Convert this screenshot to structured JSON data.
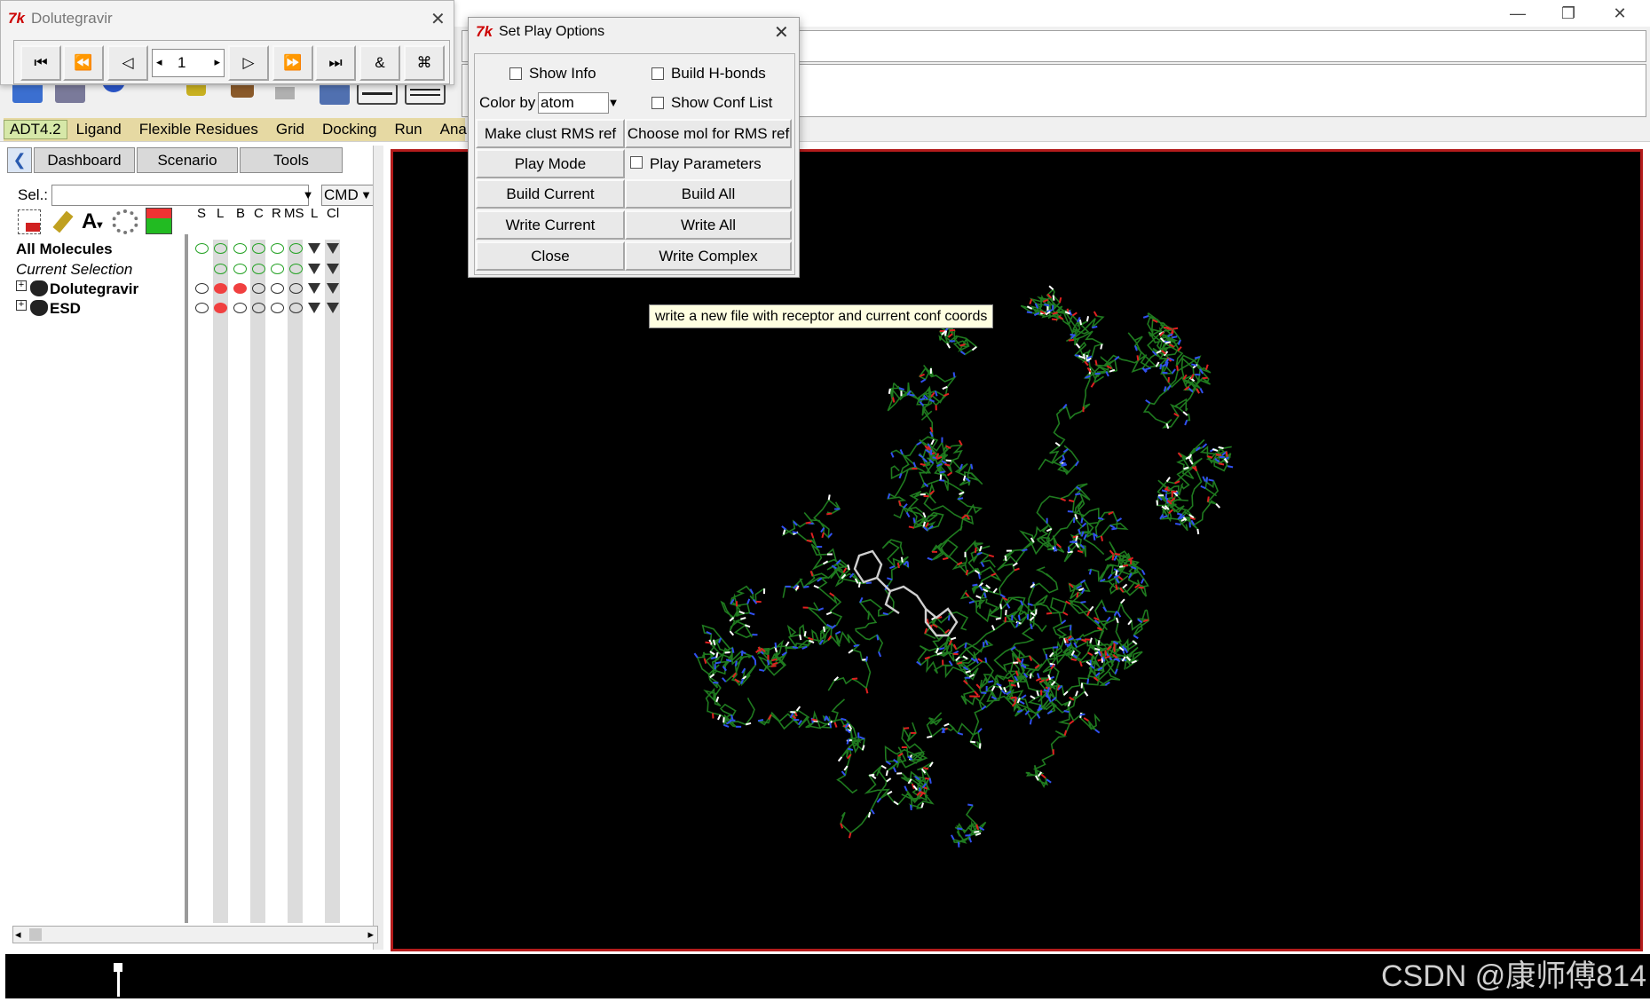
{
  "player_window": {
    "title": "Dolutegravir",
    "frame_value": "1",
    "buttons": [
      "⏮",
      "⏪",
      "◁",
      "▷",
      "⏩",
      "⏭",
      "&",
      "⌘"
    ]
  },
  "dialog": {
    "title": "Set Play Options",
    "show_info": "Show Info",
    "build_hbonds": "Build  H-bonds",
    "color_by_label": "Color by",
    "color_by_value": "atom",
    "show_conf_list": "Show Conf List",
    "make_clust": "Make clust RMS ref",
    "choose_mol": "Choose mol for RMS ref",
    "play_mode": "Play Mode",
    "play_parameters": "Play Parameters",
    "build_current": "Build Current",
    "build_all": "Build All",
    "write_current": "Write Current",
    "write_all": "Write All",
    "close": "Close",
    "write_complex": "Write Complex"
  },
  "tooltip": "write a new file with receptor and current conf coords",
  "menubar": {
    "items": [
      "ADT4.2",
      "Ligand",
      "Flexible Residues",
      "Grid",
      "Docking",
      "Run",
      "Anal"
    ]
  },
  "left_panel": {
    "tabs": [
      "Dashboard",
      "Scenario",
      "Tools"
    ],
    "sel_label": "Sel.:",
    "cmd_label": "CMD",
    "columns": [
      "S",
      "L",
      "B",
      "C",
      "R",
      "MS",
      "L",
      "Cl"
    ],
    "rows": [
      "All Molecules",
      "Current Selection",
      "Dolutegravir",
      "ESD"
    ]
  },
  "watermark": "CSDN @康师傅814",
  "colors": {
    "viewer_bg": "#000000",
    "viewer_border": "#b31b1b",
    "menubar_bg": "#e6d9a3",
    "protein_green": "#1f7a1f",
    "atom_blue": "#3050f0",
    "atom_red": "#e02020",
    "ligand_gray": "#cfcfcf"
  }
}
